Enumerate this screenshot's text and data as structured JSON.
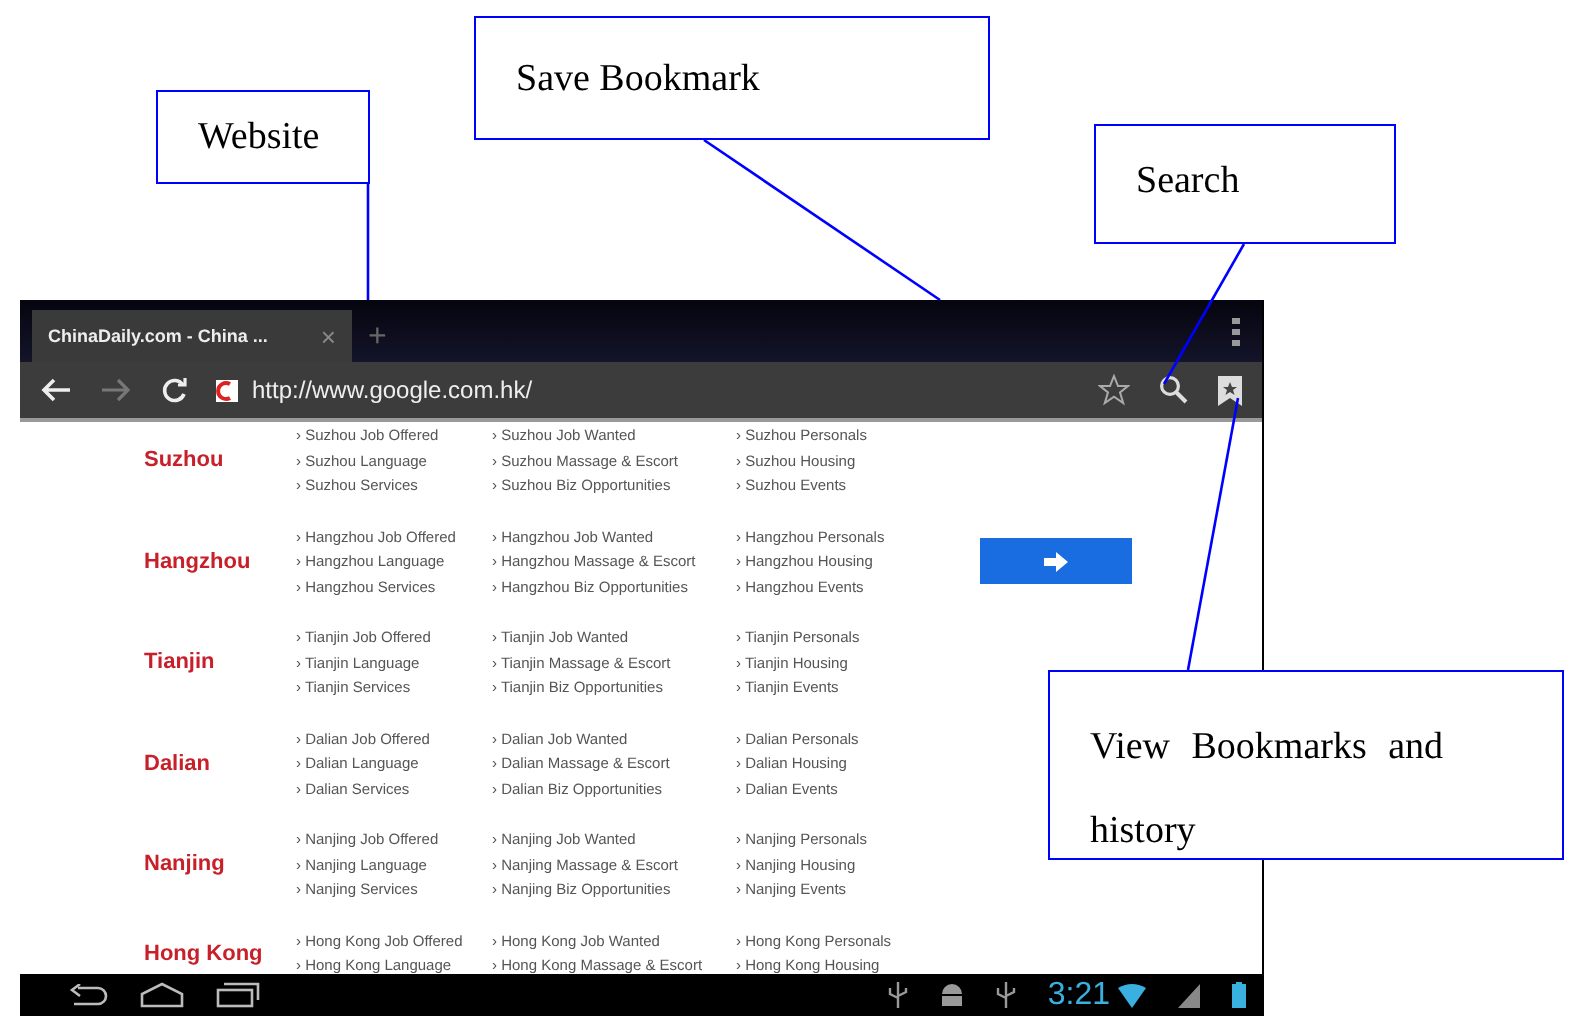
{
  "callouts": [
    {
      "text": "Website"
    },
    {
      "text": "Save Bookmark"
    },
    {
      "text": "Search"
    },
    {
      "text": "View Bookmarks and history"
    }
  ],
  "browser": {
    "tab": {
      "title": "ChinaDaily.com - China ...",
      "close": "×",
      "selected": true
    },
    "new_tab": "+",
    "url": "http://www.google.com.hk/"
  },
  "cities": [
    {
      "name": "Suzhou",
      "links": [
        "› Suzhou Job Offered",
        "› Suzhou Job Wanted",
        "› Suzhou Personals",
        "› Suzhou Language",
        "› Suzhou Massage & Escort",
        "› Suzhou Housing",
        "› Suzhou Services",
        "› Suzhou Biz Opportunities",
        "› Suzhou Events"
      ]
    },
    {
      "name": "Hangzhou",
      "links": [
        "› Hangzhou Job Offered",
        "› Hangzhou Job Wanted",
        "› Hangzhou Personals",
        "› Hangzhou Language",
        "› Hangzhou Massage & Escort",
        "› Hangzhou Housing",
        "› Hangzhou Services",
        "› Hangzhou Biz Opportunities",
        "› Hangzhou Events"
      ],
      "go_button": true
    },
    {
      "name": "Tianjin",
      "links": [
        "› Tianjin Job Offered",
        "› Tianjin Job Wanted",
        "› Tianjin Personals",
        "› Tianjin Language",
        "› Tianjin Massage & Escort",
        "› Tianjin Housing",
        "› Tianjin Services",
        "› Tianjin Biz Opportunities",
        "› Tianjin Events"
      ]
    },
    {
      "name": "Dalian",
      "links": [
        "› Dalian Job Offered",
        "› Dalian Job Wanted",
        "› Dalian Personals",
        "› Dalian Language",
        "› Dalian Massage & Escort",
        "› Dalian Housing",
        "› Dalian Services",
        "› Dalian Biz Opportunities",
        "› Dalian Events"
      ]
    },
    {
      "name": "Nanjing",
      "links": [
        "› Nanjing Job Offered",
        "› Nanjing Job Wanted",
        "› Nanjing Personals",
        "› Nanjing Language",
        "› Nanjing Massage & Escort",
        "› Nanjing Housing",
        "› Nanjing Services",
        "› Nanjing Biz Opportunities",
        "› Nanjing Events"
      ]
    },
    {
      "name": "Hong Kong",
      "links": [
        "› Hong Kong Job Offered",
        "› Hong Kong Job Wanted",
        "› Hong Kong Personals",
        "› Hong Kong Language",
        "› Hong Kong Massage & Escort",
        "› Hong Kong Housing"
      ]
    }
  ],
  "status_bar": {
    "time": "3:21"
  }
}
